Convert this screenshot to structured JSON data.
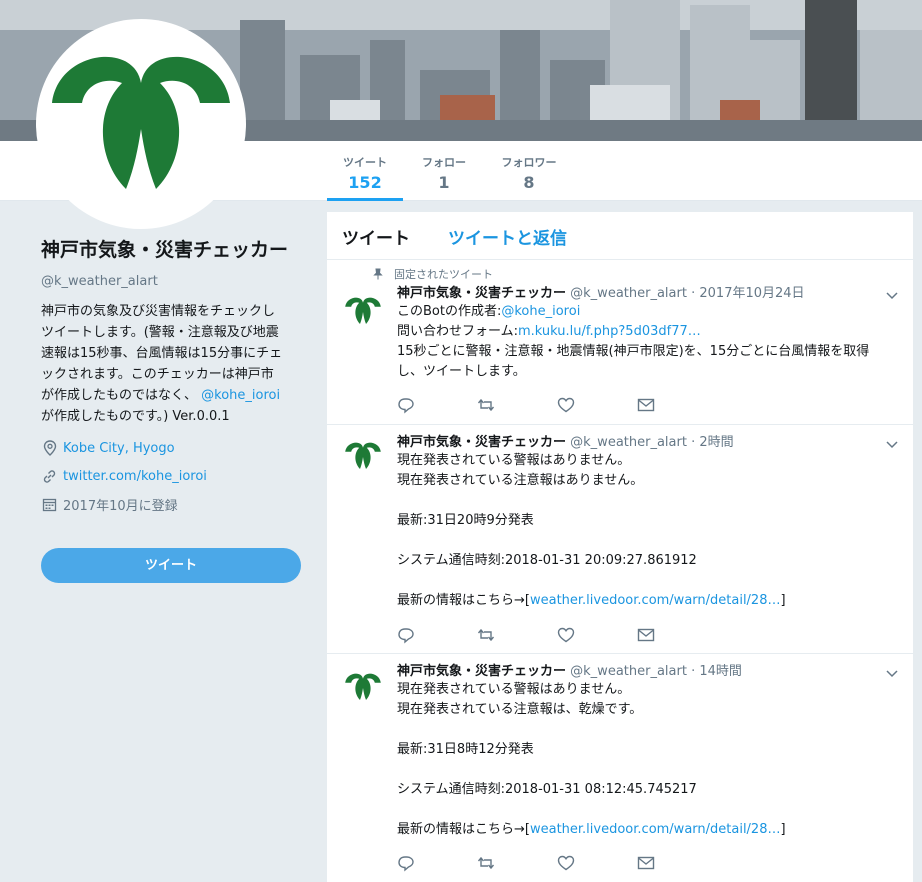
{
  "colors": {
    "accent": "#1da1f2",
    "link": "#1b95e0",
    "emblem": "#1e7a36",
    "button": "#4ba8e8"
  },
  "nav": {
    "stats": [
      {
        "label": "ツイート",
        "value": "152"
      },
      {
        "label": "フォロー",
        "value": "1"
      },
      {
        "label": "フォロワー",
        "value": "8"
      }
    ]
  },
  "profile": {
    "name": "神戸市気象・災害チェッカー",
    "handle": "@k_weather_alart",
    "bio_lines": [
      "神戸市の気象及び災害情報をチェックし",
      "ツイートします。(警報・注意報及び地震",
      "速報は15秒事、台風情報は15分事にチェ",
      "ックされます。このチェッカーは神戸市",
      "が作成したものではなく、",
      "が作成したものです。) Ver.0.0.1"
    ],
    "bio_mention": "@kohe_ioroi",
    "location": "Kobe City, Hyogo",
    "website": "twitter.com/kohe_ioroi",
    "joined": "2017年10月に登録",
    "tweet_button": "ツイート"
  },
  "timeline": {
    "tabs": [
      "ツイート",
      "ツイートと返信"
    ],
    "pinned_label": "固定されたツイート",
    "tweets": [
      {
        "name": "神戸市気象・災害チェッカー",
        "handle": "@k_weather_alart",
        "time": "2017年10月24日",
        "l1_pre": "このBotの作成者:",
        "l1_link": "@kohe_ioroi",
        "l2_pre": "問い合わせフォーム:",
        "l2_link": "m.kuku.lu/f.php?5d03df77…",
        "l3": "15秒ごとに警報・注意報・地震情報(神戸市限定)を、15分ごとに台風情報を取得",
        "l4": "し、ツイートします。"
      },
      {
        "name": "神戸市気象・災害チェッカー",
        "handle": "@k_weather_alart",
        "time": "2時間",
        "l1": "現在発表されている警報はありません。",
        "l2": "現在発表されている注意報はありません。",
        "l3": "最新:31日20時9分発表",
        "l4": "システム通信時刻:2018-01-31 20:09:27.861912",
        "l5_pre": "最新の情報はこちら→[",
        "l5_link": "weather.livedoor.com/warn/detail/28…",
        "l5_post": "]"
      },
      {
        "name": "神戸市気象・災害チェッカー",
        "handle": "@k_weather_alart",
        "time": "14時間",
        "l1": "現在発表されている警報はありません。",
        "l2": "現在発表されている注意報は、乾燥です。",
        "l3": "最新:31日8時12分発表",
        "l4": "システム通信時刻:2018-01-31 08:12:45.745217",
        "l5_pre": "最新の情報はこちら→[",
        "l5_link": "weather.livedoor.com/warn/detail/28…",
        "l5_post": "]"
      }
    ]
  },
  "icons": [
    "pin-icon",
    "location-icon",
    "link-icon",
    "calendar-icon",
    "reply-icon",
    "retweet-icon",
    "like-icon",
    "message-icon",
    "chevron-down-icon"
  ]
}
